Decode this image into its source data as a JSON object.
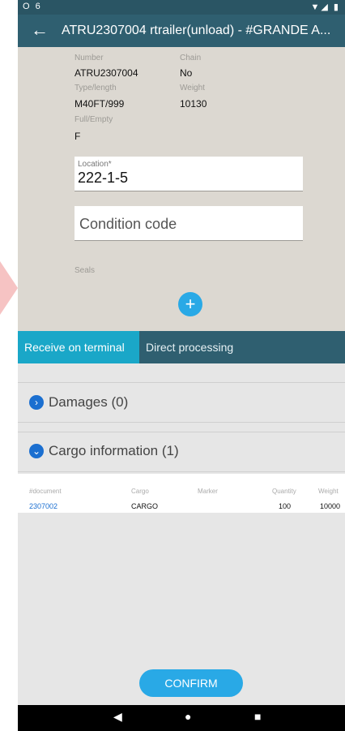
{
  "statusbar": {
    "left": "O 6",
    "right": "▼◢ ▮"
  },
  "header": {
    "back_label": "←",
    "title": "ATRU2307004 rtrailer(unload) - #GRANDE A..."
  },
  "details": {
    "number_label": "Number",
    "number": "ATRU2307004",
    "chain_label": "Chain",
    "chain": "No",
    "type_label": "Type/length",
    "type": "M40FT/999",
    "weight_label": "Weight",
    "weight": "10130",
    "fullempty_label": "Full/Empty",
    "fullempty": "F"
  },
  "location": {
    "label": "Location*",
    "value": "222-1-5"
  },
  "condition": {
    "placeholder": "Condition code"
  },
  "seals": {
    "label": "Seals"
  },
  "fab": {
    "label": "+"
  },
  "tabs": [
    {
      "label": "Receive on terminal"
    },
    {
      "label": "Direct processing"
    }
  ],
  "damages": {
    "title": "Damages (0)",
    "icon": "chevron-right-icon"
  },
  "cargo": {
    "title": "Cargo information (1)",
    "icon": "chevron-down-icon",
    "columns": [
      "#document",
      "Cargo",
      "Marker",
      "Quantity",
      "Weight"
    ],
    "rows": [
      {
        "document": "2307002",
        "cargo": "CARGO",
        "marker": "",
        "quantity": "100",
        "weight": "10000"
      }
    ]
  },
  "confirm_label": "CONFIRM",
  "navbar": {
    "back": "◀",
    "home": "●",
    "recent": "■"
  },
  "colors": {
    "primary": "#2f5f70",
    "accent": "#29a9e6",
    "tab_active": "#1aa7c8",
    "link": "#1b6fd0"
  }
}
